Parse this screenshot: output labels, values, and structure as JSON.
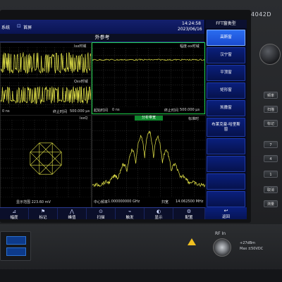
{
  "status": {
    "left_label": "系统",
    "recall_label": "首屏",
    "time": "14:24:58",
    "date": "2023/06/16"
  },
  "title": "外参考",
  "panel_i": {
    "title": "Ixx时域",
    "ylabels": [
      "1",
      "-1"
    ]
  },
  "panel_q": {
    "title": "Qxx时域",
    "xleft": "0 ns",
    "xright_label": "终止时间",
    "xright_value": "500.000 µs"
  },
  "panel_amp": {
    "title": "幅度-xx时域",
    "xleft_label": "起始时间",
    "xleft_value": "0 ns",
    "xright_label": "终止时间",
    "xright_value": "500.000 µs"
  },
  "panel_iq": {
    "title": "IxxQ",
    "bottom": "显示范围 223.60 mV"
  },
  "panel_fft": {
    "title": "分析带宽",
    "badge": "标准时",
    "center_label": "中心频率",
    "center_value": "1.000000000 GHz",
    "span_label": "扫宽",
    "span_value": "14.062500 MHz"
  },
  "menu": {
    "title": "FFT窗类型",
    "items": [
      "高斯窗",
      "汉宁窗",
      "平顶窗",
      "矩形窗",
      "凯撒窗",
      "布莱克曼-哈里斯窗",
      "",
      ""
    ]
  },
  "softkeys": [
    {
      "icon": "amplitude-icon",
      "glyph": "⊿",
      "label": "幅度"
    },
    {
      "icon": "marker-icon",
      "glyph": "⚑",
      "label": "标记"
    },
    {
      "icon": "peak-icon",
      "glyph": "⋀",
      "label": "峰值"
    },
    {
      "icon": "scan-icon",
      "glyph": "⊙",
      "label": "扫描"
    },
    {
      "icon": "trigger-icon",
      "glyph": "⌁",
      "label": "触发"
    },
    {
      "icon": "display-icon",
      "glyph": "◐",
      "label": "显示"
    },
    {
      "icon": "config-icon",
      "glyph": "⚙",
      "label": "配置"
    }
  ],
  "back_key": {
    "icon": "back-icon",
    "glyph": "↩",
    "label": "返回"
  },
  "model": "4042D",
  "hw_keys_left": [
    "",
    "",
    "",
    ""
  ],
  "hw_keys_right": [
    "频率",
    "扫描",
    "标记",
    "测量"
  ],
  "numpad": [
    "7",
    "4",
    "1",
    "取消"
  ],
  "rf_label": "RF In",
  "rf_spec_1": "+27dBm",
  "rf_spec_2": "Max ±50VDC",
  "colors": {
    "accent": "#2a6cf0",
    "trace": "#e8e84a",
    "grid": "#333333",
    "frame": "#1ed04a"
  }
}
